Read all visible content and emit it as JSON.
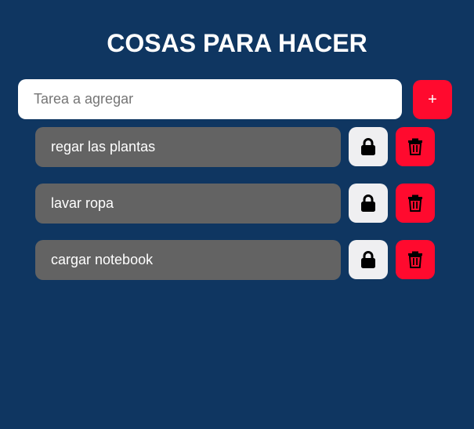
{
  "header": {
    "title": "COSAS PARA HACER"
  },
  "add_task": {
    "placeholder": "Tarea a agregar",
    "value": "",
    "button_label": "+"
  },
  "tasks": [
    {
      "label": "regar las plantas",
      "lock_icon": "lock-icon",
      "delete_icon": "trash-icon"
    },
    {
      "label": "lavar ropa",
      "lock_icon": "lock-icon",
      "delete_icon": "trash-icon"
    },
    {
      "label": "cargar notebook",
      "lock_icon": "lock-icon",
      "delete_icon": "trash-icon"
    }
  ],
  "colors": {
    "background": "#0f3661",
    "accent": "#ff0a2e",
    "task_background": "#636363",
    "lock_button_background": "#efeff1",
    "text": "#ffffff"
  }
}
